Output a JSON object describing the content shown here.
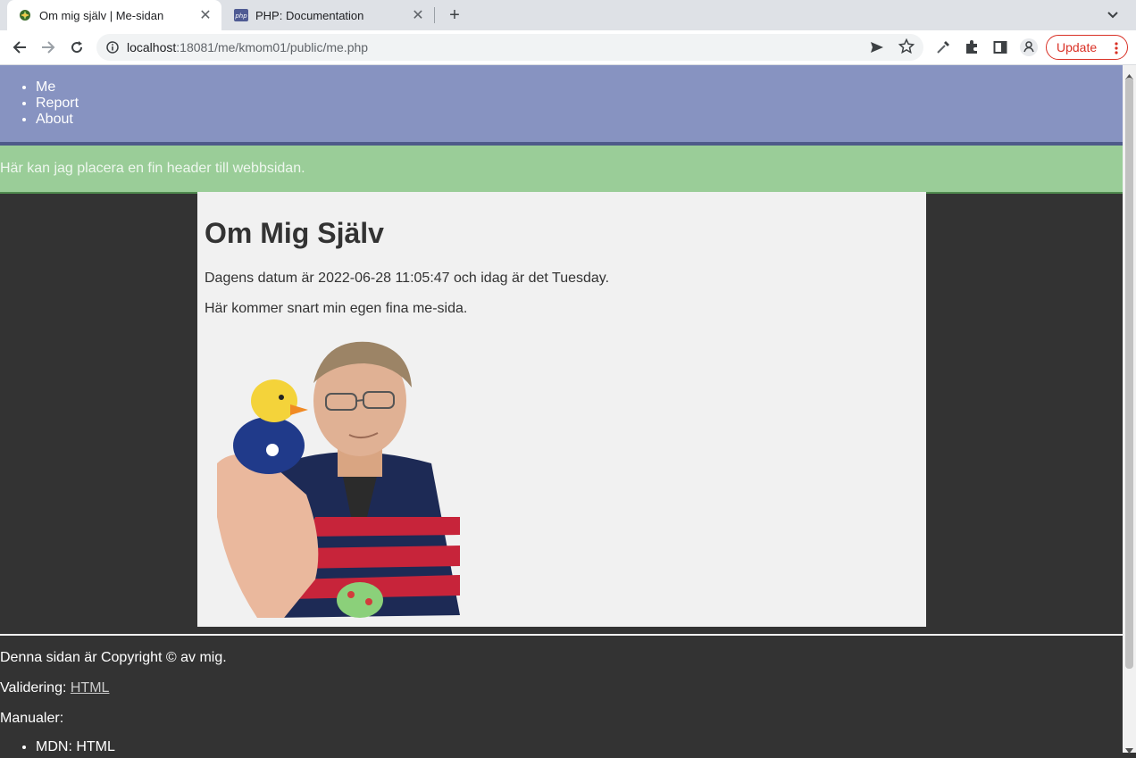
{
  "browser": {
    "tabs": [
      {
        "title": "Om mig själv | Me-sidan",
        "active": true,
        "favicon": "dbwebb-leaf-icon"
      },
      {
        "title": "PHP: Documentation",
        "active": false,
        "favicon": "php-icon"
      }
    ],
    "url_host": "localhost",
    "url_path": ":18081/me/kmom01/public/me.php",
    "update_label": "Update",
    "colors": {
      "update": "#d93025",
      "tabstrip": "#dee1e6"
    }
  },
  "nav": {
    "items": [
      "Me",
      "Report",
      "About"
    ],
    "colors": {
      "background": "#8793c1",
      "border": "#4e5a8a"
    }
  },
  "header": {
    "text": "Här kan jag placera en fin header till webbsidan.",
    "colors": {
      "background": "#9acd98"
    }
  },
  "main": {
    "title": "Om Mig Själv",
    "date_text": "Dagens datum är 2022-06-28 11:05:47 och idag är det Tuesday.",
    "intro": "Här kommer snart min egen fina me-sida.",
    "image": "person-holding-rubber-duck-photo"
  },
  "footer": {
    "copyright": "Denna sidan är Copyright © av mig.",
    "validation_label": "Validering:",
    "validation_link": "HTML",
    "manuals_label": "Manualer:",
    "manual_items": [
      "MDN: HTML"
    ]
  }
}
